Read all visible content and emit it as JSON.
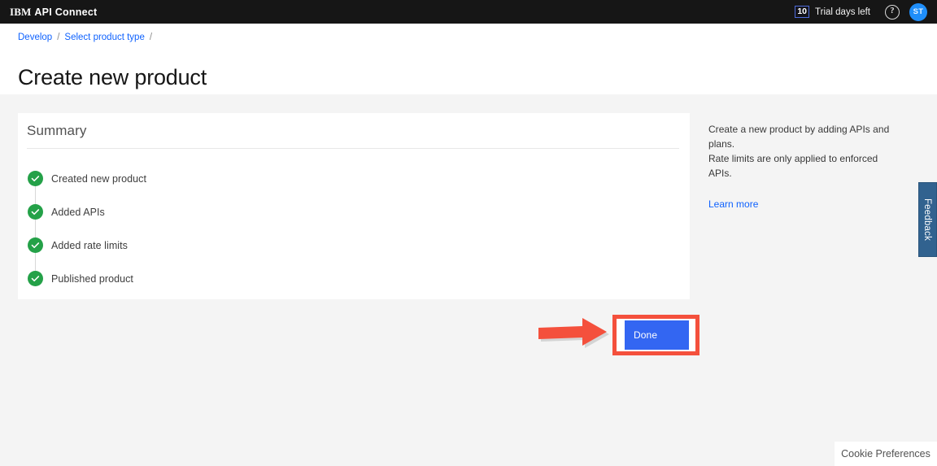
{
  "header": {
    "brand_prefix": "IBM",
    "brand_name": "API Connect",
    "trial_days": "10",
    "trial_label": "Trial days left",
    "help_glyph": "?",
    "avatar_initials": "ST"
  },
  "breadcrumb": {
    "items": [
      {
        "label": "Develop"
      },
      {
        "label": "Select product type"
      }
    ],
    "separator": "/",
    "trailing_separator": "/"
  },
  "page": {
    "title": "Create new product"
  },
  "summary": {
    "heading": "Summary",
    "steps": [
      {
        "label": "Created new product",
        "state": "complete"
      },
      {
        "label": "Added APIs",
        "state": "complete"
      },
      {
        "label": "Added rate limits",
        "state": "complete"
      },
      {
        "label": "Published product",
        "state": "complete"
      }
    ]
  },
  "info": {
    "line1": "Create a new product by adding APIs and plans.",
    "line2": "Rate limits are only applied to enforced APIs.",
    "learn_more": "Learn more"
  },
  "actions": {
    "done_label": "Done"
  },
  "feedback": {
    "label": "Feedback"
  },
  "cookie": {
    "label": "Cookie Preferences"
  },
  "colors": {
    "header_bg": "#161616",
    "page_bg": "#f4f4f4",
    "card_bg": "#ffffff",
    "link": "#0f62fe",
    "success": "#24a148",
    "primary_button": "#3366f2",
    "annotation": "#f4503c",
    "avatar": "#1f8efa",
    "feedback_tab": "#31628f"
  }
}
